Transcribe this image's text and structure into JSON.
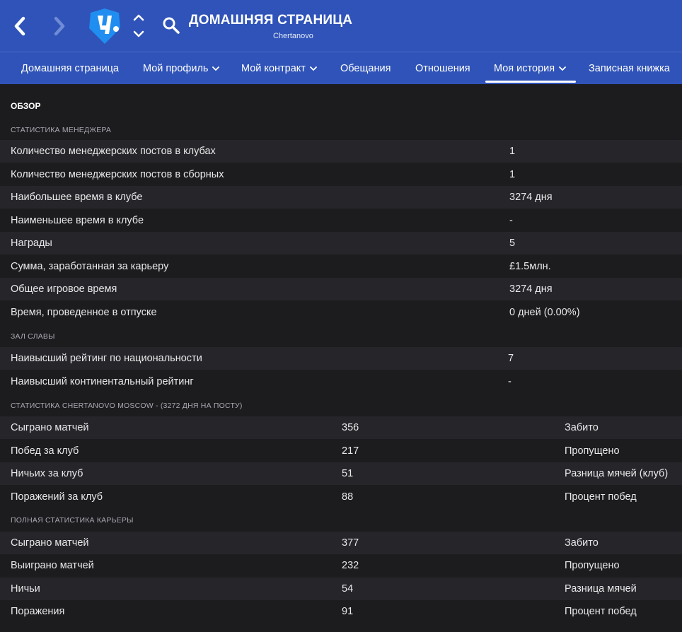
{
  "header": {
    "title": "ДОМАШНЯЯ СТРАНИЦА",
    "subtitle": "Chertanovo",
    "icons": {
      "back": "chevron-left-icon",
      "forward": "chevron-right-icon",
      "logo": "club-logo",
      "switch": "up-down-chevrons-icon",
      "search": "search-icon"
    },
    "colors": {
      "bar": "#2f53b8",
      "logo": "#1f8ef0"
    }
  },
  "tabs": [
    {
      "label": "Домашняя страница",
      "dropdown": false
    },
    {
      "label": "Мой профиль",
      "dropdown": true
    },
    {
      "label": "Мой контракт",
      "dropdown": true
    },
    {
      "label": "Обещания",
      "dropdown": false
    },
    {
      "label": "Отношения",
      "dropdown": false
    },
    {
      "label": "Моя история",
      "dropdown": true,
      "active": true
    },
    {
      "label": "Записная книжка",
      "dropdown": false
    }
  ],
  "overview": {
    "heading": "ОБЗОР",
    "manager_section": "СТАТИСТИКА МЕНЕДЖЕРА",
    "manager_rows": [
      {
        "label": "Количество менеджерских постов в клубах",
        "value": "1"
      },
      {
        "label": "Количество менеджерских постов в сборных",
        "value": "1"
      },
      {
        "label": "Наибольшее время в клубе",
        "value": "3274 дня"
      },
      {
        "label": "Наименьшее время в клубе",
        "value": "-"
      },
      {
        "label": "Награды",
        "value": "5"
      },
      {
        "label": "Сумма, заработанная за карьеру",
        "value": "£1.5млн."
      },
      {
        "label": "Общее игровое время",
        "value": "3274 дня"
      },
      {
        "label": "Время, проведенное в отпуске",
        "value": "0 дней (0.00%)"
      }
    ],
    "hall_section": "ЗАЛ СЛАВЫ",
    "hall_rows": [
      {
        "label": "Наивысший рейтинг по национальности",
        "value": "7"
      },
      {
        "label": "Наивысший континентальный рейтинг",
        "value": "-"
      }
    ],
    "club_section": "СТАТИСТИКА CHERTANOVO MOSCOW - (3272 ДНЯ НА ПОСТУ)",
    "club_rows": [
      {
        "label": "Сыграно матчей",
        "value": "356",
        "right_label": "Забито"
      },
      {
        "label": "Побед за клуб",
        "value": "217",
        "right_label": "Пропущено"
      },
      {
        "label": "Ничьих за клуб",
        "value": "51",
        "right_label": "Разница мячей (клуб)"
      },
      {
        "label": "Поражений за клуб",
        "value": "88",
        "right_label": "Процент побед"
      }
    ],
    "career_section": "ПОЛНАЯ СТАТИСТИКА КАРЬЕРЫ",
    "career_rows": [
      {
        "label": "Сыграно матчей",
        "value": "377",
        "right_label": "Забито"
      },
      {
        "label": "Выиграно матчей",
        "value": "232",
        "right_label": "Пропущено"
      },
      {
        "label": "Ничьи",
        "value": "54",
        "right_label": "Разница мячей"
      },
      {
        "label": "Поражения",
        "value": "91",
        "right_label": "Процент побед"
      }
    ]
  }
}
